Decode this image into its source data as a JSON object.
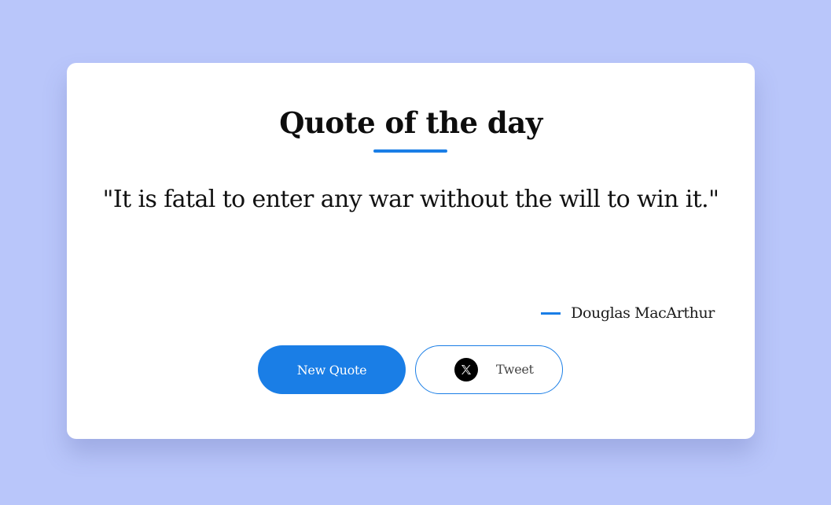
{
  "page": {
    "background_color": "#b9c6fa",
    "accent_color": "#1a7ee6"
  },
  "card": {
    "title": "Quote of the day",
    "quote": "\"It is fatal to enter any war without the will to win it.\"",
    "author": "Douglas MacArthur"
  },
  "actions": {
    "new_quote_label": "New Quote",
    "tweet_label": "Tweet",
    "tweet_icon": "x-logo-icon"
  }
}
